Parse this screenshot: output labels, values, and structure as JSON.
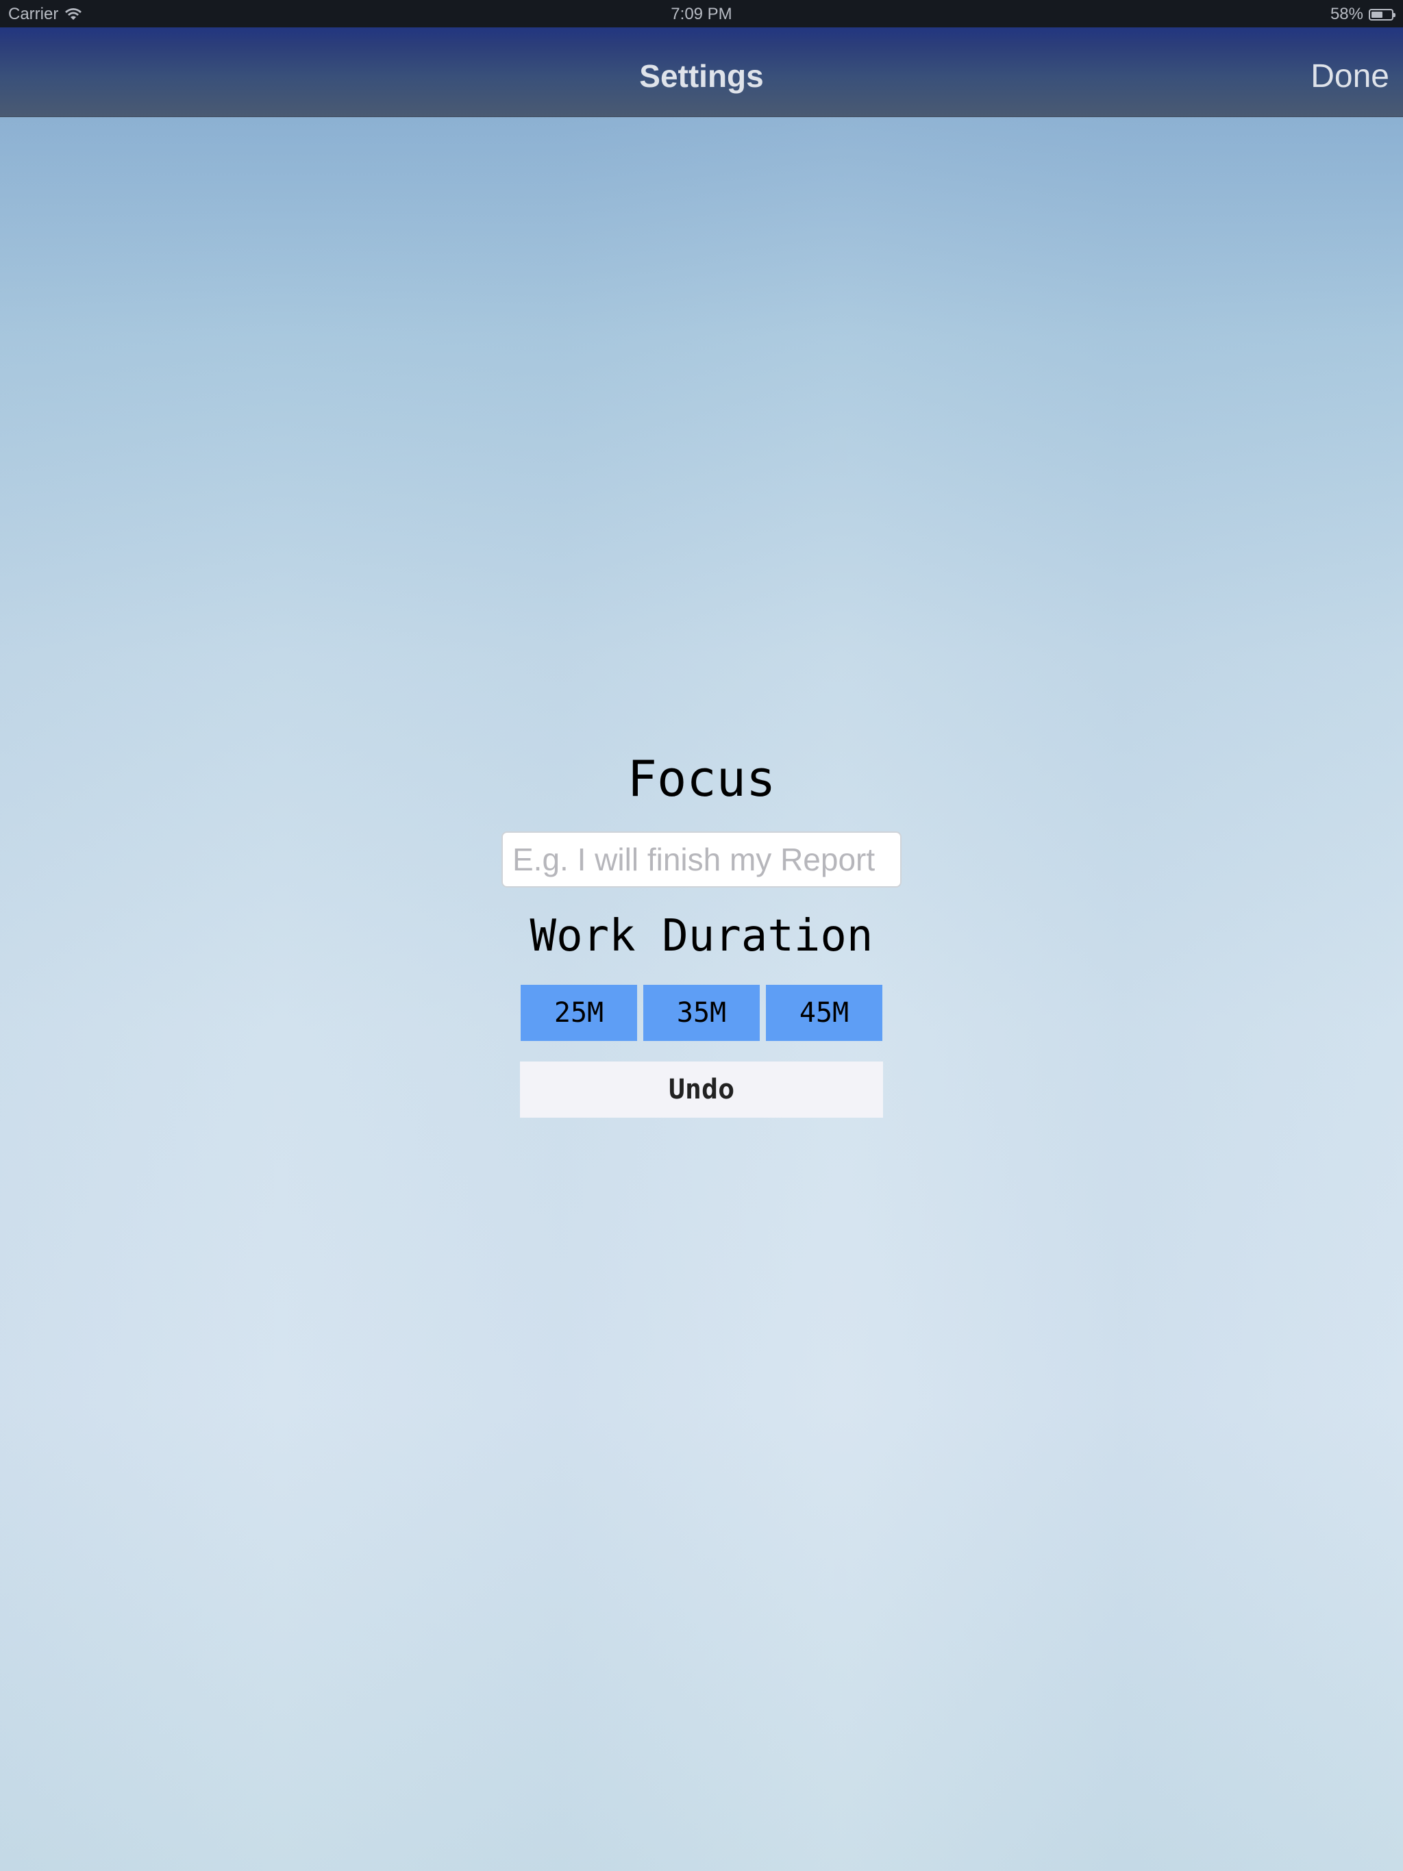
{
  "status_bar": {
    "carrier": "Carrier",
    "time": "7:09 PM",
    "battery_percent": "58%",
    "battery_level": 0.58
  },
  "nav": {
    "title": "Settings",
    "done_label": "Done"
  },
  "main": {
    "focus_title": "Focus",
    "goal_placeholder": "E.g. I will finish my Report",
    "goal_value": "",
    "duration_title": "Work Duration",
    "durations": [
      "25M",
      "35M",
      "45M"
    ],
    "undo_label": "Undo"
  },
  "colors": {
    "duration_button": "#5e9ef5",
    "undo_button": "#f3f3f8",
    "nav_bar": "#2c3e7a"
  }
}
